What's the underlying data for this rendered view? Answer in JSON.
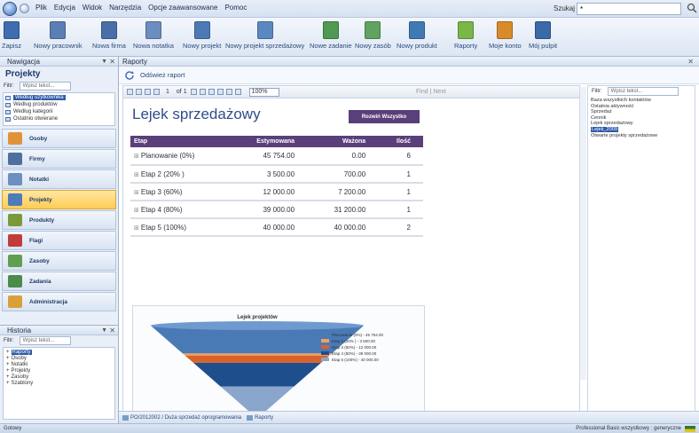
{
  "menubar": {
    "items": [
      "Plik",
      "Edycja",
      "Widok",
      "Narzędzia",
      "Opcje zaawansowane",
      "Pomoc"
    ],
    "search_label": "Szukaj",
    "search_value": "*"
  },
  "ribbon": {
    "buttons": [
      {
        "label": "Zapisz",
        "icon": "save-icon",
        "color": "#3f6db0"
      },
      {
        "label": "Nowy pracownik",
        "icon": "new-employee-icon",
        "color": "#5b7fb5"
      },
      {
        "label": "Nowa firma",
        "icon": "new-company-icon",
        "color": "#4a6fa8"
      },
      {
        "label": "Nowa notatka",
        "icon": "new-note-icon",
        "color": "#6c8dbf"
      },
      {
        "label": "Nowy projekt",
        "icon": "new-project-icon",
        "color": "#4c79b6"
      },
      {
        "label": "Nowy projekt sprzedażowy",
        "icon": "new-sales-project-icon",
        "color": "#5c88c2"
      },
      {
        "label": "Nowe zadanie",
        "icon": "new-task-icon",
        "color": "#4f9a52"
      },
      {
        "label": "Nowy zasób",
        "icon": "new-resource-icon",
        "color": "#5fa35f"
      },
      {
        "label": "Nowy produkt",
        "icon": "new-product-icon",
        "color": "#3f7ab3"
      },
      {
        "label": "Raporty",
        "icon": "reports-icon",
        "color": "#7ab648"
      },
      {
        "label": "Moje konto",
        "icon": "my-account-icon",
        "color": "#d98b2b"
      },
      {
        "label": "Mój pulpit",
        "icon": "my-desktop-icon",
        "color": "#3a6aa8"
      }
    ]
  },
  "nav": {
    "header": "Nawigacja",
    "title": "Projekty",
    "filter_label": "Filtr:",
    "filter_placeholder": "Wpisz tekst...",
    "tree": [
      {
        "label": "Według użytkownika",
        "selected": true
      },
      {
        "label": "Według produktów",
        "selected": false
      },
      {
        "label": "Według kategorii",
        "selected": false
      },
      {
        "label": "Ostatnio otwierane",
        "selected": false
      }
    ],
    "buttons": [
      {
        "label": "Osoby",
        "color": "#e0943a",
        "active": false
      },
      {
        "label": "Firmy",
        "color": "#4f6f9e",
        "active": false
      },
      {
        "label": "Notatki",
        "color": "#6d8fc2",
        "active": false
      },
      {
        "label": "Projekty",
        "color": "#4f7bb8",
        "active": true
      },
      {
        "label": "Produkty",
        "color": "#7a9a3a",
        "active": false
      },
      {
        "label": "Flagi",
        "color": "#c23b3b",
        "active": false
      },
      {
        "label": "Zasoby",
        "color": "#5f9f4f",
        "active": false
      },
      {
        "label": "Zadania",
        "color": "#4a8c4a",
        "active": false
      },
      {
        "label": "Administracja",
        "color": "#d9a03a",
        "active": false
      }
    ]
  },
  "history": {
    "header": "Historia",
    "filter_label": "Filtr:",
    "filter_placeholder": "Wpisz tekst...",
    "items": [
      {
        "label": "Raporty",
        "selected": true
      },
      {
        "label": "Osoby",
        "selected": false
      },
      {
        "label": "Notatki",
        "selected": false
      },
      {
        "label": "Projekty",
        "selected": false
      },
      {
        "label": "Zasoby",
        "selected": false
      },
      {
        "label": "Szablony",
        "selected": false
      }
    ]
  },
  "reports": {
    "tab_label": "Raporty",
    "refresh_label": "Odśwież raport",
    "viewer": {
      "page_current": "1",
      "page_total": "of 1",
      "zoom": "100%",
      "find_label": "Find | Next"
    },
    "report_title": "Lejek sprzedażowy",
    "expand_button": "Rozwiń Wszystko",
    "table": {
      "headers": [
        "Etap",
        "Estymowana",
        "Ważona",
        "Ilość"
      ],
      "rows": [
        {
          "stage": "Planowanie (0%)",
          "estimated": "45 754.00",
          "weighted": "0.00",
          "count": "6"
        },
        {
          "stage": "Etap 2 (20% )",
          "estimated": "3 500.00",
          "weighted": "700.00",
          "count": "1"
        },
        {
          "stage": "Etap 3 (60%)",
          "estimated": "12 000.00",
          "weighted": "7 200.00",
          "count": "1"
        },
        {
          "stage": "Etap 4 (80%)",
          "estimated": "39 000.00",
          "weighted": "31 200.00",
          "count": "1"
        },
        {
          "stage": "Etap 5 (100%)",
          "estimated": "40 000.00",
          "weighted": "40 000.00",
          "count": "2"
        }
      ]
    }
  },
  "chart_data": {
    "type": "funnel",
    "title": "Lejek projektów",
    "series": [
      {
        "label": "Planowanie (0%) - 45 754.00",
        "value": 45754,
        "color": "#4a7ab5"
      },
      {
        "label": "Etap 2 (20% ) - 3 500.00",
        "value": 3500,
        "color": "#f0a060"
      },
      {
        "label": "Etap 3 (60%) - 12 000.00",
        "value": 12000,
        "color": "#d9622b"
      },
      {
        "label": "Etap 4 (80%) - 39 000.00",
        "value": 39000,
        "color": "#1f4e8c"
      },
      {
        "label": "Etap 5 (100%) - 40 000.00",
        "value": 40000,
        "color": "#8aa6cc"
      }
    ]
  },
  "right_panel": {
    "filter_label": "Filtr:",
    "filter_placeholder": "Wpisz tekst...",
    "items": [
      {
        "label": "Baza wszystkich kontaktów",
        "selected": false
      },
      {
        "label": "Ostatnia aktywność",
        "selected": false
      },
      {
        "label": "Sprzedaż",
        "selected": false
      },
      {
        "label": "Cennik",
        "selected": false
      },
      {
        "label": "Lejek sprzedażowy",
        "selected": false
      },
      {
        "label": "Lejek_2009",
        "selected": true
      },
      {
        "label": "Otwarte projekty sprzedażowe",
        "selected": false
      }
    ]
  },
  "bottom_tabs": [
    {
      "label": "PO/2012002 / Duża sprzedaż oprogramowania"
    },
    {
      "label": "Raporty"
    }
  ],
  "status": {
    "left": "Gotowy",
    "right": "Professional Basic wszystkowy : generyczne"
  }
}
